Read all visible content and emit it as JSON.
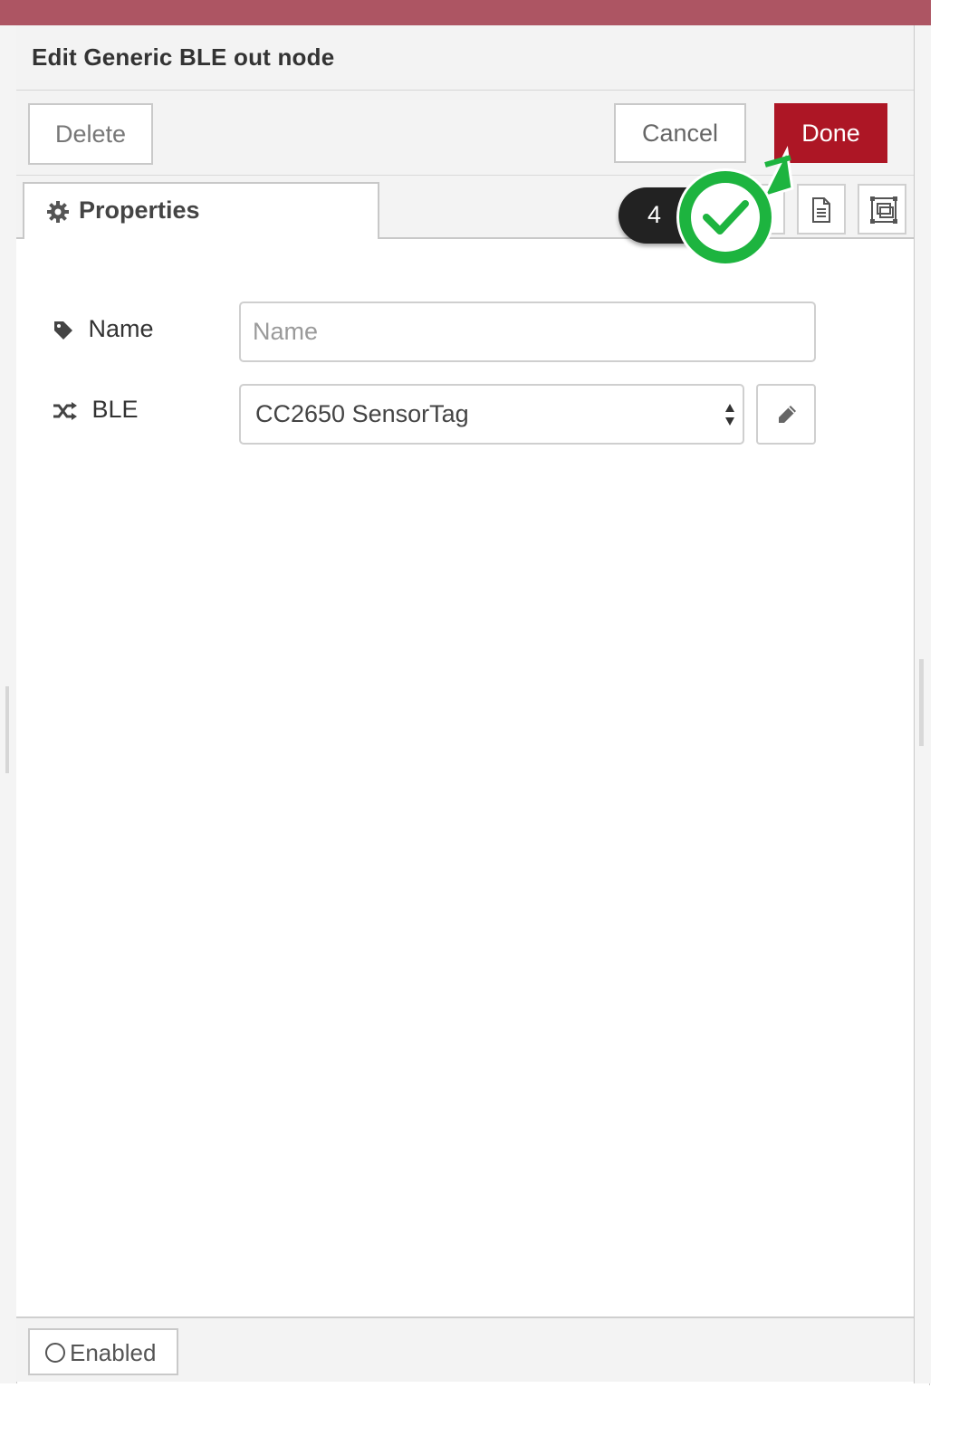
{
  "dialog": {
    "title": "Edit Generic BLE out node",
    "buttons": {
      "delete": "Delete",
      "cancel": "Cancel",
      "done": "Done"
    }
  },
  "tabs": [
    {
      "label": "Properties",
      "icon": "gear-icon",
      "active": true
    }
  ],
  "tab_actions": [
    {
      "icon": "document-icon"
    },
    {
      "icon": "expand-icon"
    }
  ],
  "form": {
    "name": {
      "label": "Name",
      "placeholder": "Name",
      "value": "",
      "icon": "tag-icon"
    },
    "ble": {
      "label": "BLE",
      "selected": "CC2650 SensorTag",
      "icon": "shuffle-icon"
    }
  },
  "footer": {
    "toggle_label": "Enabled"
  },
  "annotation": {
    "step": "4",
    "color": "#1db43f"
  },
  "colors": {
    "accent": "#ad1625",
    "header_bar": "#ad5563"
  }
}
